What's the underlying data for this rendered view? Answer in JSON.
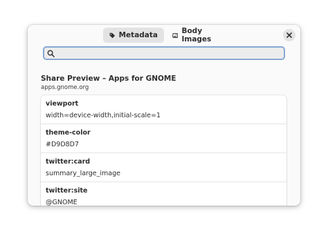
{
  "tabs": [
    {
      "label": "Metadata",
      "icon": "tag-icon",
      "active": true
    },
    {
      "label": "Body Images",
      "icon": "image-icon",
      "active": false
    }
  ],
  "search": {
    "value": "",
    "placeholder": ""
  },
  "page": {
    "title": "Share Preview – Apps for GNOME",
    "url": "apps.gnome.org"
  },
  "metadata": [
    {
      "key": "viewport",
      "value": "width=device-width,initial-scale=1"
    },
    {
      "key": "theme-color",
      "value": "#D9D8D7"
    },
    {
      "key": "twitter:card",
      "value": "summary_large_image"
    },
    {
      "key": "twitter:site",
      "value": "@GNOME"
    }
  ],
  "colors": {
    "focus_ring": "#86a8d3",
    "tab_active_bg": "#e3e3e3",
    "window_bg": "#fafafa"
  }
}
